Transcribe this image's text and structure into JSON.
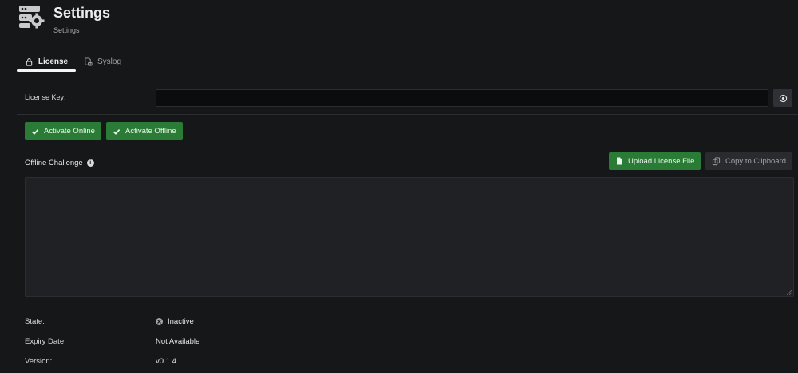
{
  "header": {
    "title": "Settings",
    "subtitle": "Settings",
    "icon": "settings-server-icon"
  },
  "tabs": [
    {
      "label": "License",
      "icon": "lock-icon",
      "active": true
    },
    {
      "label": "Syslog",
      "icon": "syslog-icon",
      "active": false
    }
  ],
  "license": {
    "key_label": "License Key:",
    "key_value": "",
    "key_placeholder": "",
    "show_button_icon": "eye-icon"
  },
  "actions": {
    "activate_online": "Activate Online",
    "activate_offline": "Activate Offline",
    "upload_license_file": "Upload License File",
    "copy_to_clipboard": "Copy to Clipboard"
  },
  "offline_challenge": {
    "label": "Offline Challenge",
    "value": ""
  },
  "status": {
    "state_label": "State:",
    "state_value": "Inactive",
    "expiry_label": "Expiry Date:",
    "expiry_value": "Not Available",
    "version_label": "Version:",
    "version_value": "v0.1.4"
  },
  "colors": {
    "background": "#161719",
    "accent_green": "#2a7b35",
    "text": "#d8d9da"
  }
}
